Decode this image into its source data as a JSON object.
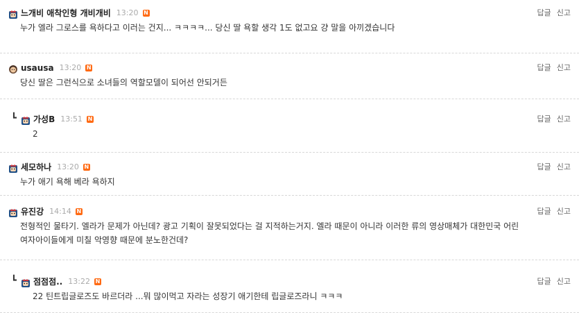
{
  "comments": [
    {
      "author": "느개비 애착인형 개비개비",
      "time": "13:20",
      "badge": "N",
      "reply_label": "답글",
      "report_label": "신고",
      "text": "누가 엘라 그로스를 욕하다고 이러는 건지... ㅋㅋㅋㅋ... 당신 딸 욕할 생각 1도 없고요 걍 말을 아끼겠습니다"
    },
    {
      "author": "usausa",
      "time": "13:20",
      "badge": "N",
      "reply_label": "답글",
      "report_label": "신고",
      "text": "당신 딸은 그런식으로 소녀들의 역할모델이 되어선 안되거든"
    },
    {
      "author": "가성B",
      "time": "13:51",
      "badge": "N",
      "reply_label": "답글",
      "report_label": "신고",
      "is_reply": true,
      "text": "2"
    },
    {
      "author": "세모하나",
      "time": "13:20",
      "badge": "N",
      "reply_label": "답글",
      "report_label": "신고",
      "text": "누가 애기 욕해 베라 욕하지"
    },
    {
      "author": "유진강",
      "time": "14:14",
      "badge": "N",
      "reply_label": "답글",
      "report_label": "신고",
      "text": "전형적인 물타기. 엘라가 문제가 아닌데? 광고 기획이 잘못되었다는 걸 지적하는거지. 엘라 때문이 아니라 이러한 류의 영상매체가 대한민국 어린 여자아이들에게 미칠 악영향 때문에 분노한건데?"
    },
    {
      "author": "점점점..",
      "time": "13:22",
      "badge": "N",
      "reply_label": "답글",
      "report_label": "신고",
      "is_reply": true,
      "text": "22 틴트립글로즈도 바르더라 ...뭐 많이먹고 자라는 성장기 애기한테 립글로즈라니 ㅋㅋㅋ"
    }
  ],
  "icons": {
    "avatar": "cartoon-avatar-icon",
    "avatar_alt": "character-avatar-icon",
    "reply_arrow": "reply-arrow-icon",
    "new_badge": "new-badge-icon"
  },
  "colors": {
    "new_badge": "#ff6a13",
    "time": "#aaaaaa",
    "divider": "#d7d7d7"
  }
}
